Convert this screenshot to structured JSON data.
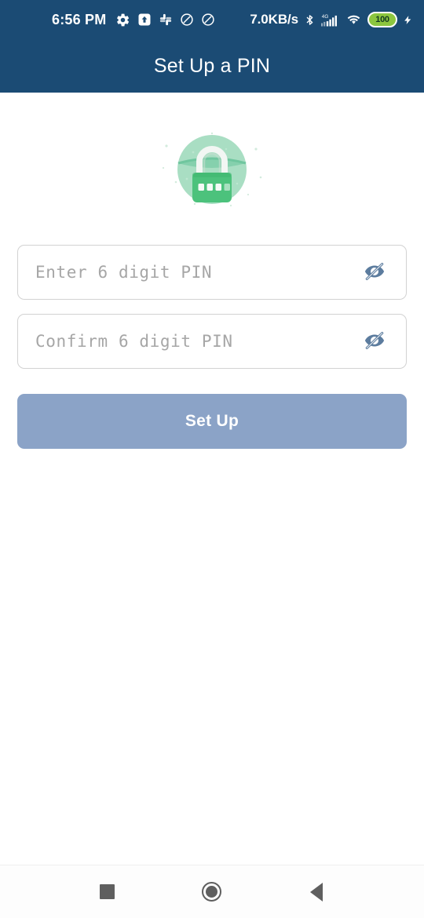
{
  "status_bar": {
    "time": "6:56 PM",
    "network_speed": "7.0KB/s",
    "battery_level": "100",
    "network_type": "4G",
    "background_color": "#1B4B74",
    "left_icons": [
      {
        "name": "settings-gear-icon"
      },
      {
        "name": "upload-box-icon"
      },
      {
        "name": "slack-icon"
      },
      {
        "name": "do-not-disturb-icon"
      },
      {
        "name": "do-not-disturb-icon"
      }
    ],
    "right_icons": [
      {
        "name": "bluetooth-icon"
      },
      {
        "name": "cellular-signal-icon"
      },
      {
        "name": "wifi-icon"
      },
      {
        "name": "battery-icon"
      },
      {
        "name": "charging-bolt-icon"
      }
    ]
  },
  "app_bar": {
    "title": "Set Up a PIN",
    "background_color": "#1B4B74",
    "title_color": "#FFFFFF"
  },
  "hero": {
    "illustration_name": "padlock-illustration",
    "circle_color": "#A9DEC3",
    "lock_body_color": "#4CC27C",
    "shackle_color": "#F1F5F2",
    "dot_count": 4
  },
  "form": {
    "pin_field": {
      "placeholder": "Enter 6 digit PIN",
      "value": "",
      "toggle_icon": "eye-off-icon",
      "toggle_color": "#5C7C9E"
    },
    "confirm_field": {
      "placeholder": "Confirm 6 digit PIN",
      "value": "",
      "toggle_icon": "eye-off-icon",
      "toggle_color": "#5C7C9E"
    },
    "submit": {
      "label": "Set Up",
      "background_color": "#8BA3C7",
      "text_color": "#FFFFFF"
    }
  },
  "nav_bar": {
    "recents_label": "Recents",
    "home_label": "Home",
    "back_label": "Back",
    "icon_color": "#5F5F5F"
  }
}
